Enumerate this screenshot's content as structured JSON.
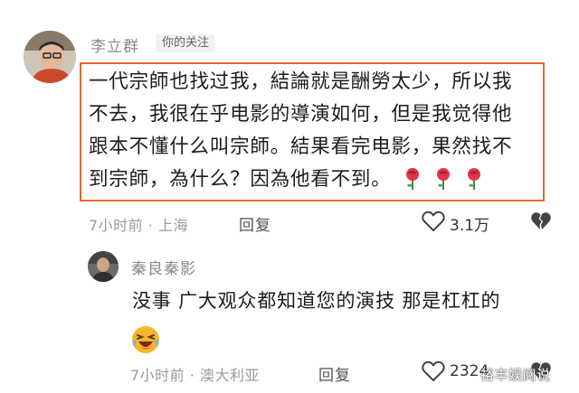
{
  "comments": [
    {
      "username": "李立群",
      "badge": "你的关注",
      "text": "一代宗師也找过我，結論就是酬勞太少，所以我\n不去，我很在乎电影的導演如何，但是我觉得他\n跟本不懂什么叫宗師。結果看完电影，果然找不\n到宗師，為什么？因為他看不到。",
      "rose_emoji_count": 3,
      "meta": "7小时前 · 上海",
      "reply_label": "回复",
      "likes": "3.1万"
    },
    {
      "username": "秦良秦影",
      "text": "没事 广大观众都知道您的演技 那是杠杠的",
      "emoji": "laughing-crying-emoji",
      "meta": "7小时前 · 澳大利亚",
      "reply_label": "回复",
      "likes": "2324"
    }
  ],
  "watermark": "裕丰娱阅说",
  "colors": {
    "highlight_border": "#e8672e",
    "meta_gray": "#9a9a9a"
  }
}
